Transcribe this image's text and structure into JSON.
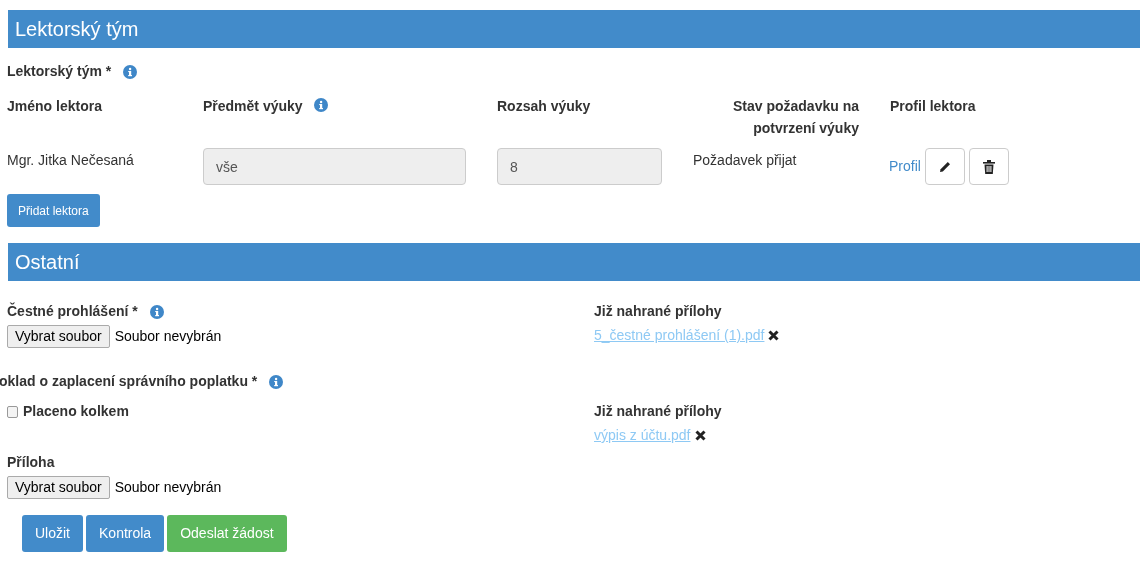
{
  "sections": [
    {
      "title": "Lektorský tým"
    },
    {
      "title": "Ostatní"
    }
  ],
  "team": {
    "label": "Lektorský tým *",
    "columns": [
      "Jméno lektora",
      "Předmět výuky",
      "Rozsah výuky",
      "Stav požadavku na potvrzení výuky",
      "Profil lektora"
    ],
    "rows": [
      {
        "name": "Mgr. Jitka Nečesaná",
        "subject": "vše",
        "range": "8",
        "status": "Požadavek přijat",
        "profile_link": "Profil"
      }
    ],
    "add_button": "Přidat lektora"
  },
  "declaration": {
    "label": "Čestné prohlášení *",
    "file_button": "Vybrat soubor",
    "file_status": "Soubor nevybrán",
    "uploaded_label": "Již nahrané přílohy",
    "uploaded_file": "5_čestné prohlášení (1).pdf"
  },
  "fee": {
    "label": "oklad o zaplacení správního poplatku *",
    "checkbox": {
      "label": "Placeno kolkem",
      "checked": false
    },
    "attachment_label": "Příloha",
    "file_button": "Vybrat soubor",
    "file_status": "Soubor nevybrán",
    "uploaded_label": "Již nahrané přílohy",
    "uploaded_file": "výpis z účtu.pdf"
  },
  "actions": [
    {
      "label": "Uložit",
      "kind": "primary"
    },
    {
      "label": "Kontrola",
      "kind": "primary"
    },
    {
      "label": "Odeslat žádost",
      "kind": "success"
    }
  ]
}
